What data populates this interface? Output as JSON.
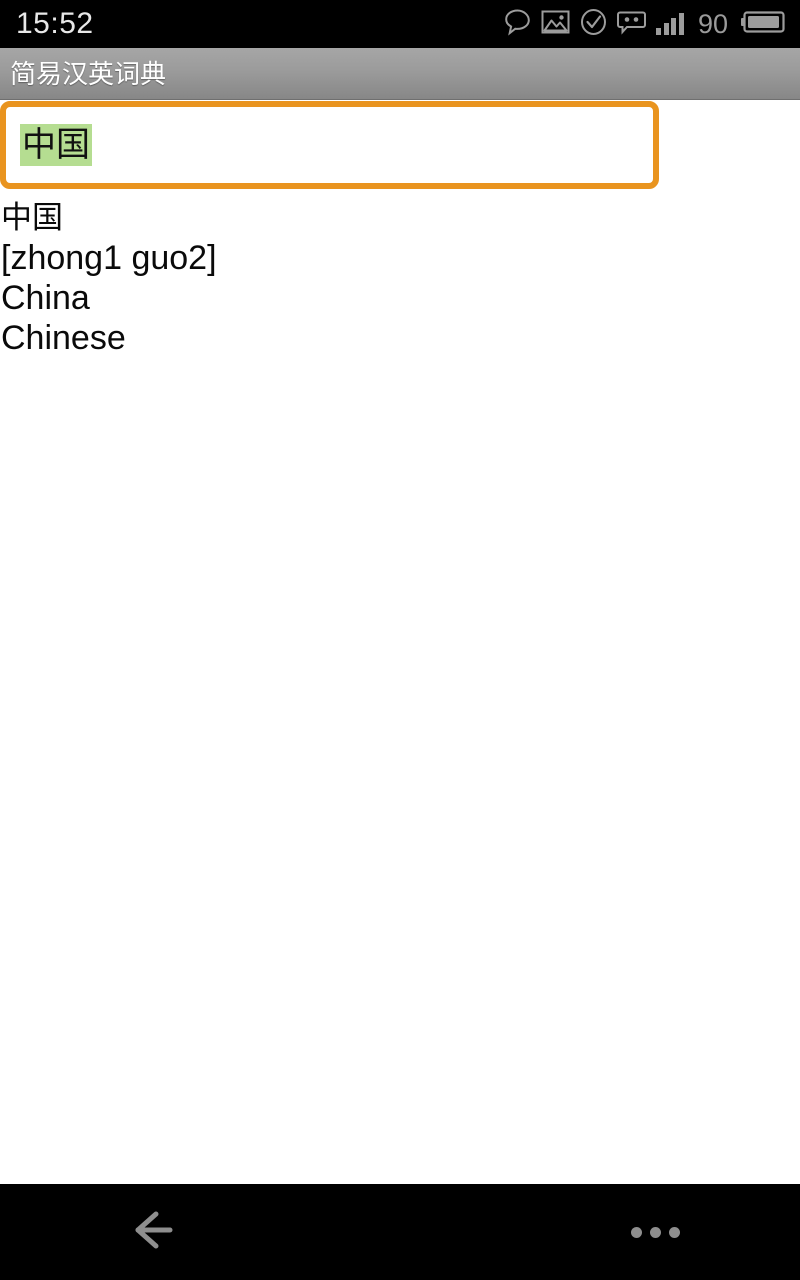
{
  "status_bar": {
    "clock": "15:52",
    "battery_percent": "90",
    "icons": [
      {
        "name": "speech-bubble-icon"
      },
      {
        "name": "photo-icon"
      },
      {
        "name": "check-circle-icon"
      },
      {
        "name": "message-icon"
      },
      {
        "name": "signal-bars-icon"
      },
      {
        "name": "battery-icon"
      }
    ],
    "colors": {
      "background": "#000000",
      "text": "#e8e8e8",
      "icon": "#c8c8c8"
    }
  },
  "title_bar": {
    "title": "简易汉英词典",
    "colors": {
      "gradient_top": "#a6a6a6",
      "gradient_bottom": "#878787",
      "text": "#ffffff"
    }
  },
  "search": {
    "value": "中国",
    "placeholder": "",
    "selection_highlight_color": "#b5dd91",
    "focus_border_color": "#e9941f",
    "button_label": "",
    "button_icon": "magnifier-icon"
  },
  "result": {
    "lines": [
      "中国",
      "[zhong1 guo2]",
      "China",
      "Chinese"
    ],
    "headword": "中国",
    "pinyin": "[zhong1 guo2]",
    "definitions": [
      "China",
      "Chinese"
    ]
  },
  "nav_bar": {
    "back_icon": "arrow-left-icon",
    "menu_icon": "overflow-menu-icon",
    "colors": {
      "background": "#000000",
      "icon": "#8e8e8e"
    }
  }
}
